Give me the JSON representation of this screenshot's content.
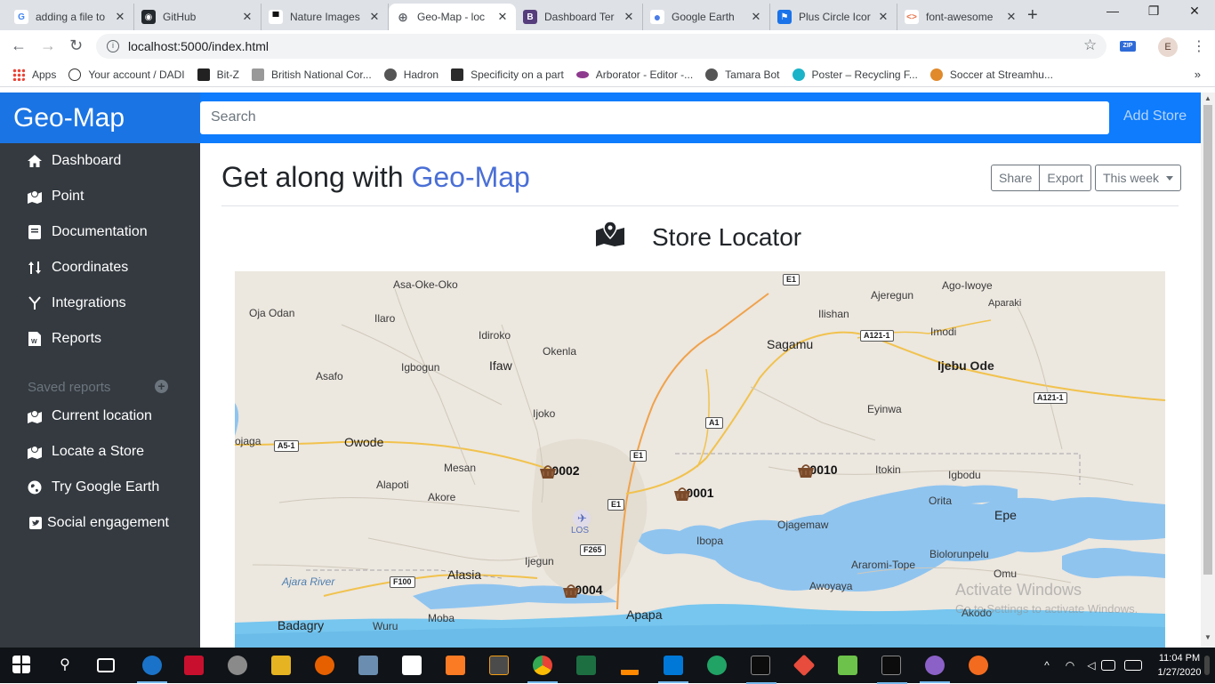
{
  "browser": {
    "tabs": [
      {
        "title": "adding a file to",
        "favicon": "G",
        "color": "#4285f4",
        "active": false
      },
      {
        "title": "GitHub",
        "favicon": "◉",
        "color": "#24292e",
        "active": false
      },
      {
        "title": "Nature Images",
        "favicon": "▀",
        "color": "#111111",
        "active": false
      },
      {
        "title": "Geo-Map - loc",
        "favicon": "⊕",
        "color": "#5f6368",
        "active": true
      },
      {
        "title": "Dashboard Ter",
        "favicon": "B",
        "color": "#563d7c",
        "active": false
      },
      {
        "title": "Google Earth",
        "favicon": "●",
        "color": "#4a7de8",
        "active": false
      },
      {
        "title": "Plus Circle Icor",
        "favicon": "⚑",
        "color": "#1a73e8",
        "active": false
      },
      {
        "title": "font-awesome",
        "favicon": "<>",
        "color": "#e8734a",
        "active": false
      }
    ],
    "url": "localhost:5000/index.html",
    "profile_initial": "E",
    "extension_label": "ZIP",
    "bookmarks": [
      {
        "label": "Apps",
        "color": "#ea4335"
      },
      {
        "label": "Your account / DADI",
        "color": "#333333"
      },
      {
        "label": "Bit-Z",
        "color": "#222222"
      },
      {
        "label": "British National Cor...",
        "color": "#888888"
      },
      {
        "label": "Hadron",
        "color": "#555555"
      },
      {
        "label": "Specificity on a part",
        "color": "#2b2b2b"
      },
      {
        "label": "Arborator - Editor -...",
        "color": "#8e3a8e"
      },
      {
        "label": "Tamara Bot",
        "color": "#555555"
      },
      {
        "label": "Poster – Recycling F...",
        "color": "#1bb3c8"
      },
      {
        "label": "Soccer at Streamhu...",
        "color": "#e08a2c"
      }
    ],
    "bookmarks_more": "»"
  },
  "app": {
    "brand": "Geo-Map",
    "search_placeholder": "Search",
    "add_store": "Add Store",
    "colors": {
      "primary": "#0e7cfc",
      "sidebar": "#343a40",
      "accent": "#4a6fd6"
    }
  },
  "sidebar": {
    "items": [
      {
        "label": "Dashboard",
        "icon": "home-icon"
      },
      {
        "label": "Point",
        "icon": "map-icon"
      },
      {
        "label": "Documentation",
        "icon": "book-icon"
      },
      {
        "label": "Coordinates",
        "icon": "sort-arrows-icon"
      },
      {
        "label": "Integrations",
        "icon": "y-fork-icon"
      },
      {
        "label": "Reports",
        "icon": "word-file-icon"
      }
    ],
    "saved_heading": "Saved reports",
    "saved_items": [
      {
        "label": "Current location",
        "icon": "map-icon"
      },
      {
        "label": "Locate a Store",
        "icon": "map-icon"
      },
      {
        "label": "Try Google Earth",
        "icon": "globe-icon"
      },
      {
        "label": "Social engagement",
        "icon": "twitter-square-icon"
      }
    ]
  },
  "main": {
    "title_prefix": "Get along with ",
    "title_accent": "Geo-Map",
    "share": "Share",
    "export": "Export",
    "period": "This week",
    "locator_title": "Store Locator"
  },
  "map": {
    "places": [
      {
        "name": "Asa-Oke-Oko",
        "type": "town"
      },
      {
        "name": "Ajeregun",
        "type": "town"
      },
      {
        "name": "Ago-Iwoye",
        "type": "town"
      },
      {
        "name": "Oja Odan",
        "type": "town"
      },
      {
        "name": "Ilaro",
        "type": "town"
      },
      {
        "name": "Ilishan",
        "type": "town"
      },
      {
        "name": "Aparaki",
        "type": "town"
      },
      {
        "name": "Idiroko",
        "type": "town"
      },
      {
        "name": "Sagamu",
        "type": "city"
      },
      {
        "name": "Imodi",
        "type": "town"
      },
      {
        "name": "Okenla",
        "type": "town"
      },
      {
        "name": "Ifaw",
        "type": "town"
      },
      {
        "name": "Igbogun",
        "type": "town"
      },
      {
        "name": "Ijebu Ode",
        "type": "city-bold"
      },
      {
        "name": "Asafo",
        "type": "town"
      },
      {
        "name": "Eyinwa",
        "type": "town"
      },
      {
        "name": "Ijoko",
        "type": "town"
      },
      {
        "name": "Owode",
        "type": "city"
      },
      {
        "name": "Mesan",
        "type": "town"
      },
      {
        "name": "Itokin",
        "type": "town"
      },
      {
        "name": "Igbodu",
        "type": "town"
      },
      {
        "name": "Alapoti",
        "type": "town"
      },
      {
        "name": "Akore",
        "type": "town"
      },
      {
        "name": "Orita",
        "type": "town"
      },
      {
        "name": "Epe",
        "type": "city"
      },
      {
        "name": "Ojagemaw",
        "type": "town"
      },
      {
        "name": "Ibopa",
        "type": "town"
      },
      {
        "name": "Ijegun",
        "type": "town"
      },
      {
        "name": "Biolorunpelu",
        "type": "town"
      },
      {
        "name": "Araromi-Tope",
        "type": "town"
      },
      {
        "name": "Alasia",
        "type": "city"
      },
      {
        "name": "Omu",
        "type": "town"
      },
      {
        "name": "Ajara River",
        "type": "water"
      },
      {
        "name": "Awoyaya",
        "type": "town"
      },
      {
        "name": "Moba",
        "type": "town"
      },
      {
        "name": "Apapa",
        "type": "city"
      },
      {
        "name": "Akodo",
        "type": "town"
      },
      {
        "name": "Badagry",
        "type": "city"
      },
      {
        "name": "Wuru",
        "type": "town"
      },
      {
        "name": "ojaga",
        "type": "town"
      },
      {
        "name": "LOS",
        "type": "airport"
      }
    ],
    "shields": [
      "E1",
      "A121-1",
      "A121-1",
      "A1",
      "A5-1",
      "E1",
      "E1",
      "F265",
      "F100"
    ],
    "markers": [
      {
        "label": "0002"
      },
      {
        "label": "0001"
      },
      {
        "label": "0010"
      },
      {
        "label": "0004"
      }
    ],
    "watermark": {
      "line1": "Activate Windows",
      "line2": "Go to Settings to activate Windows."
    }
  },
  "taskbar": {
    "time": "11:04 PM",
    "date": "1/27/2020"
  }
}
